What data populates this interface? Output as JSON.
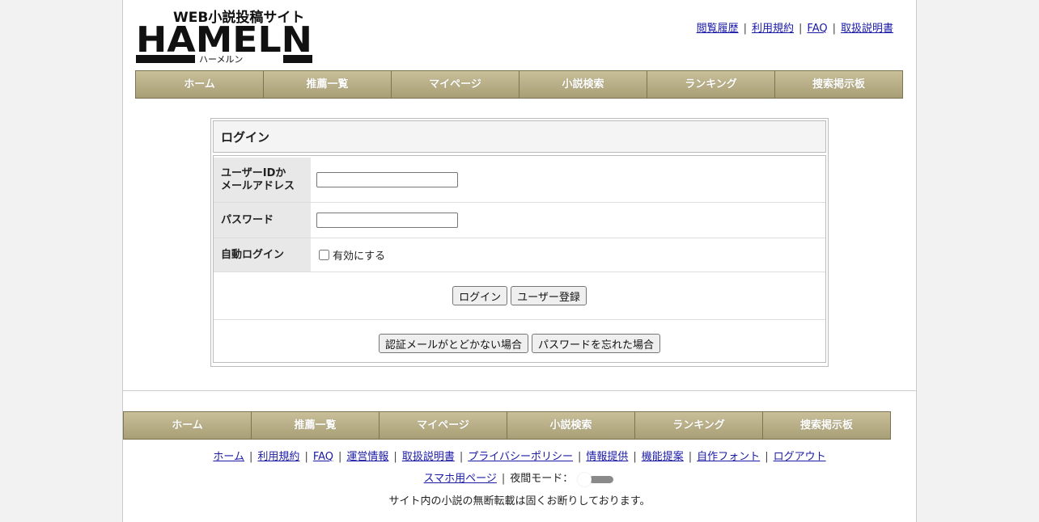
{
  "header": {
    "logo_text": "HAMELN",
    "logo_sub": "ハーメルン",
    "logo_tag": "WEB小説投稿サイト",
    "links": [
      "閲覧履歴",
      "利用規約",
      "FAQ",
      "取扱説明書"
    ]
  },
  "nav": [
    "ホーム",
    "推薦一覧",
    "マイページ",
    "小説検索",
    "ランキング",
    "捜索掲示板"
  ],
  "login": {
    "title": "ログイン",
    "user_label_1": "ユーザーIDか",
    "user_label_2": "メールアドレス",
    "user_value": "",
    "password_label": "パスワード",
    "password_value": "",
    "auto_login_label": "自動ログイン",
    "auto_login_option": "有効にする",
    "login_button": "ログイン",
    "register_button": "ユーザー登録",
    "no_mail_button": "認証メールがとどかない場合",
    "forgot_button": "パスワードを忘れた場合"
  },
  "footer": {
    "nav": [
      "ホーム",
      "推薦一覧",
      "マイページ",
      "小説検索",
      "ランキング",
      "捜索掲示板"
    ],
    "links": [
      "ホーム",
      "利用規約",
      "FAQ",
      "運営情報",
      "取扱説明書",
      "プライバシーポリシー",
      "情報提供",
      "機能提案",
      "自作フォント",
      "ログアウト"
    ],
    "mobile_link": "スマホ用ページ",
    "night_mode_label": "夜間モード：",
    "night_mode_on": false,
    "notice": "サイト内の小説の無断転載は固くお断りしております。"
  }
}
